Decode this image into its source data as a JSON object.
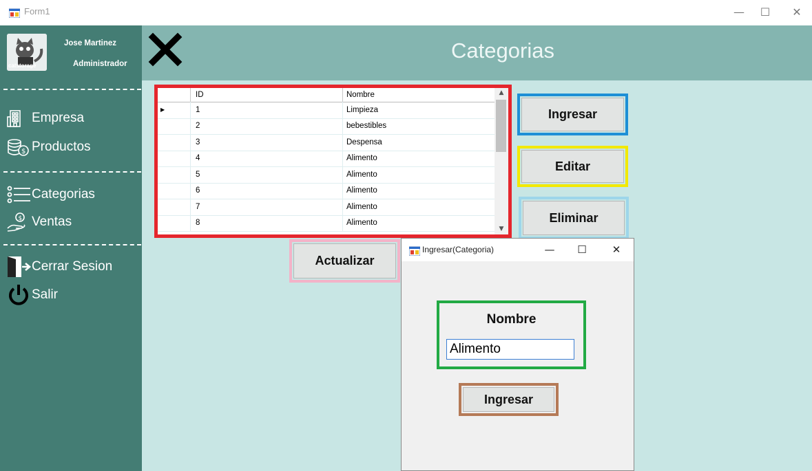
{
  "window": {
    "title": "Form1",
    "minimize": "—",
    "maximize": "☐",
    "close": "✕"
  },
  "sidebar": {
    "avatar_caption": "catstorage",
    "user_name": "Jose Martinez",
    "user_role": "Administrador",
    "items": [
      {
        "label": "Empresa",
        "icon": "building-icon"
      },
      {
        "label": "Productos",
        "icon": "coins-icon"
      },
      {
        "label": "Categorias",
        "icon": "list-icon"
      },
      {
        "label": "Ventas",
        "icon": "hand-coin-icon"
      },
      {
        "label": "Cerrar Sesion",
        "icon": "door-exit-icon"
      },
      {
        "label": "Salir",
        "icon": "power-icon"
      }
    ]
  },
  "header": {
    "title": "Categorias"
  },
  "grid": {
    "columns": [
      "ID",
      "Nombre"
    ],
    "rows": [
      [
        "1",
        "Limpieza"
      ],
      [
        "2",
        "bebestibles"
      ],
      [
        "3",
        "Despensa"
      ],
      [
        "4",
        "Alimento"
      ],
      [
        "5",
        "Alimento"
      ],
      [
        "6",
        "Alimento"
      ],
      [
        "7",
        "Alimento"
      ],
      [
        "8",
        "Alimento"
      ]
    ]
  },
  "actions": {
    "ingresar": "Ingresar",
    "editar": "Editar",
    "eliminar": "Eliminar",
    "actualizar": "Actualizar"
  },
  "dialog": {
    "title": "Ingresar(Categoria)",
    "field_label": "Nombre",
    "field_value": "Alimento",
    "submit": "Ingresar"
  },
  "colors": {
    "sidebar": "#447d74",
    "header": "#84b5b0",
    "content": "#c8e6e4",
    "grid_frame": "#e5262d",
    "ingresar_frame": "#1e8fd6",
    "editar_frame": "#f2e900",
    "eliminar_frame": "#9dd6ea",
    "actualizar_frame": "#f3b3c8",
    "nombre_frame": "#22aa44",
    "submit_frame": "#b57a57"
  }
}
